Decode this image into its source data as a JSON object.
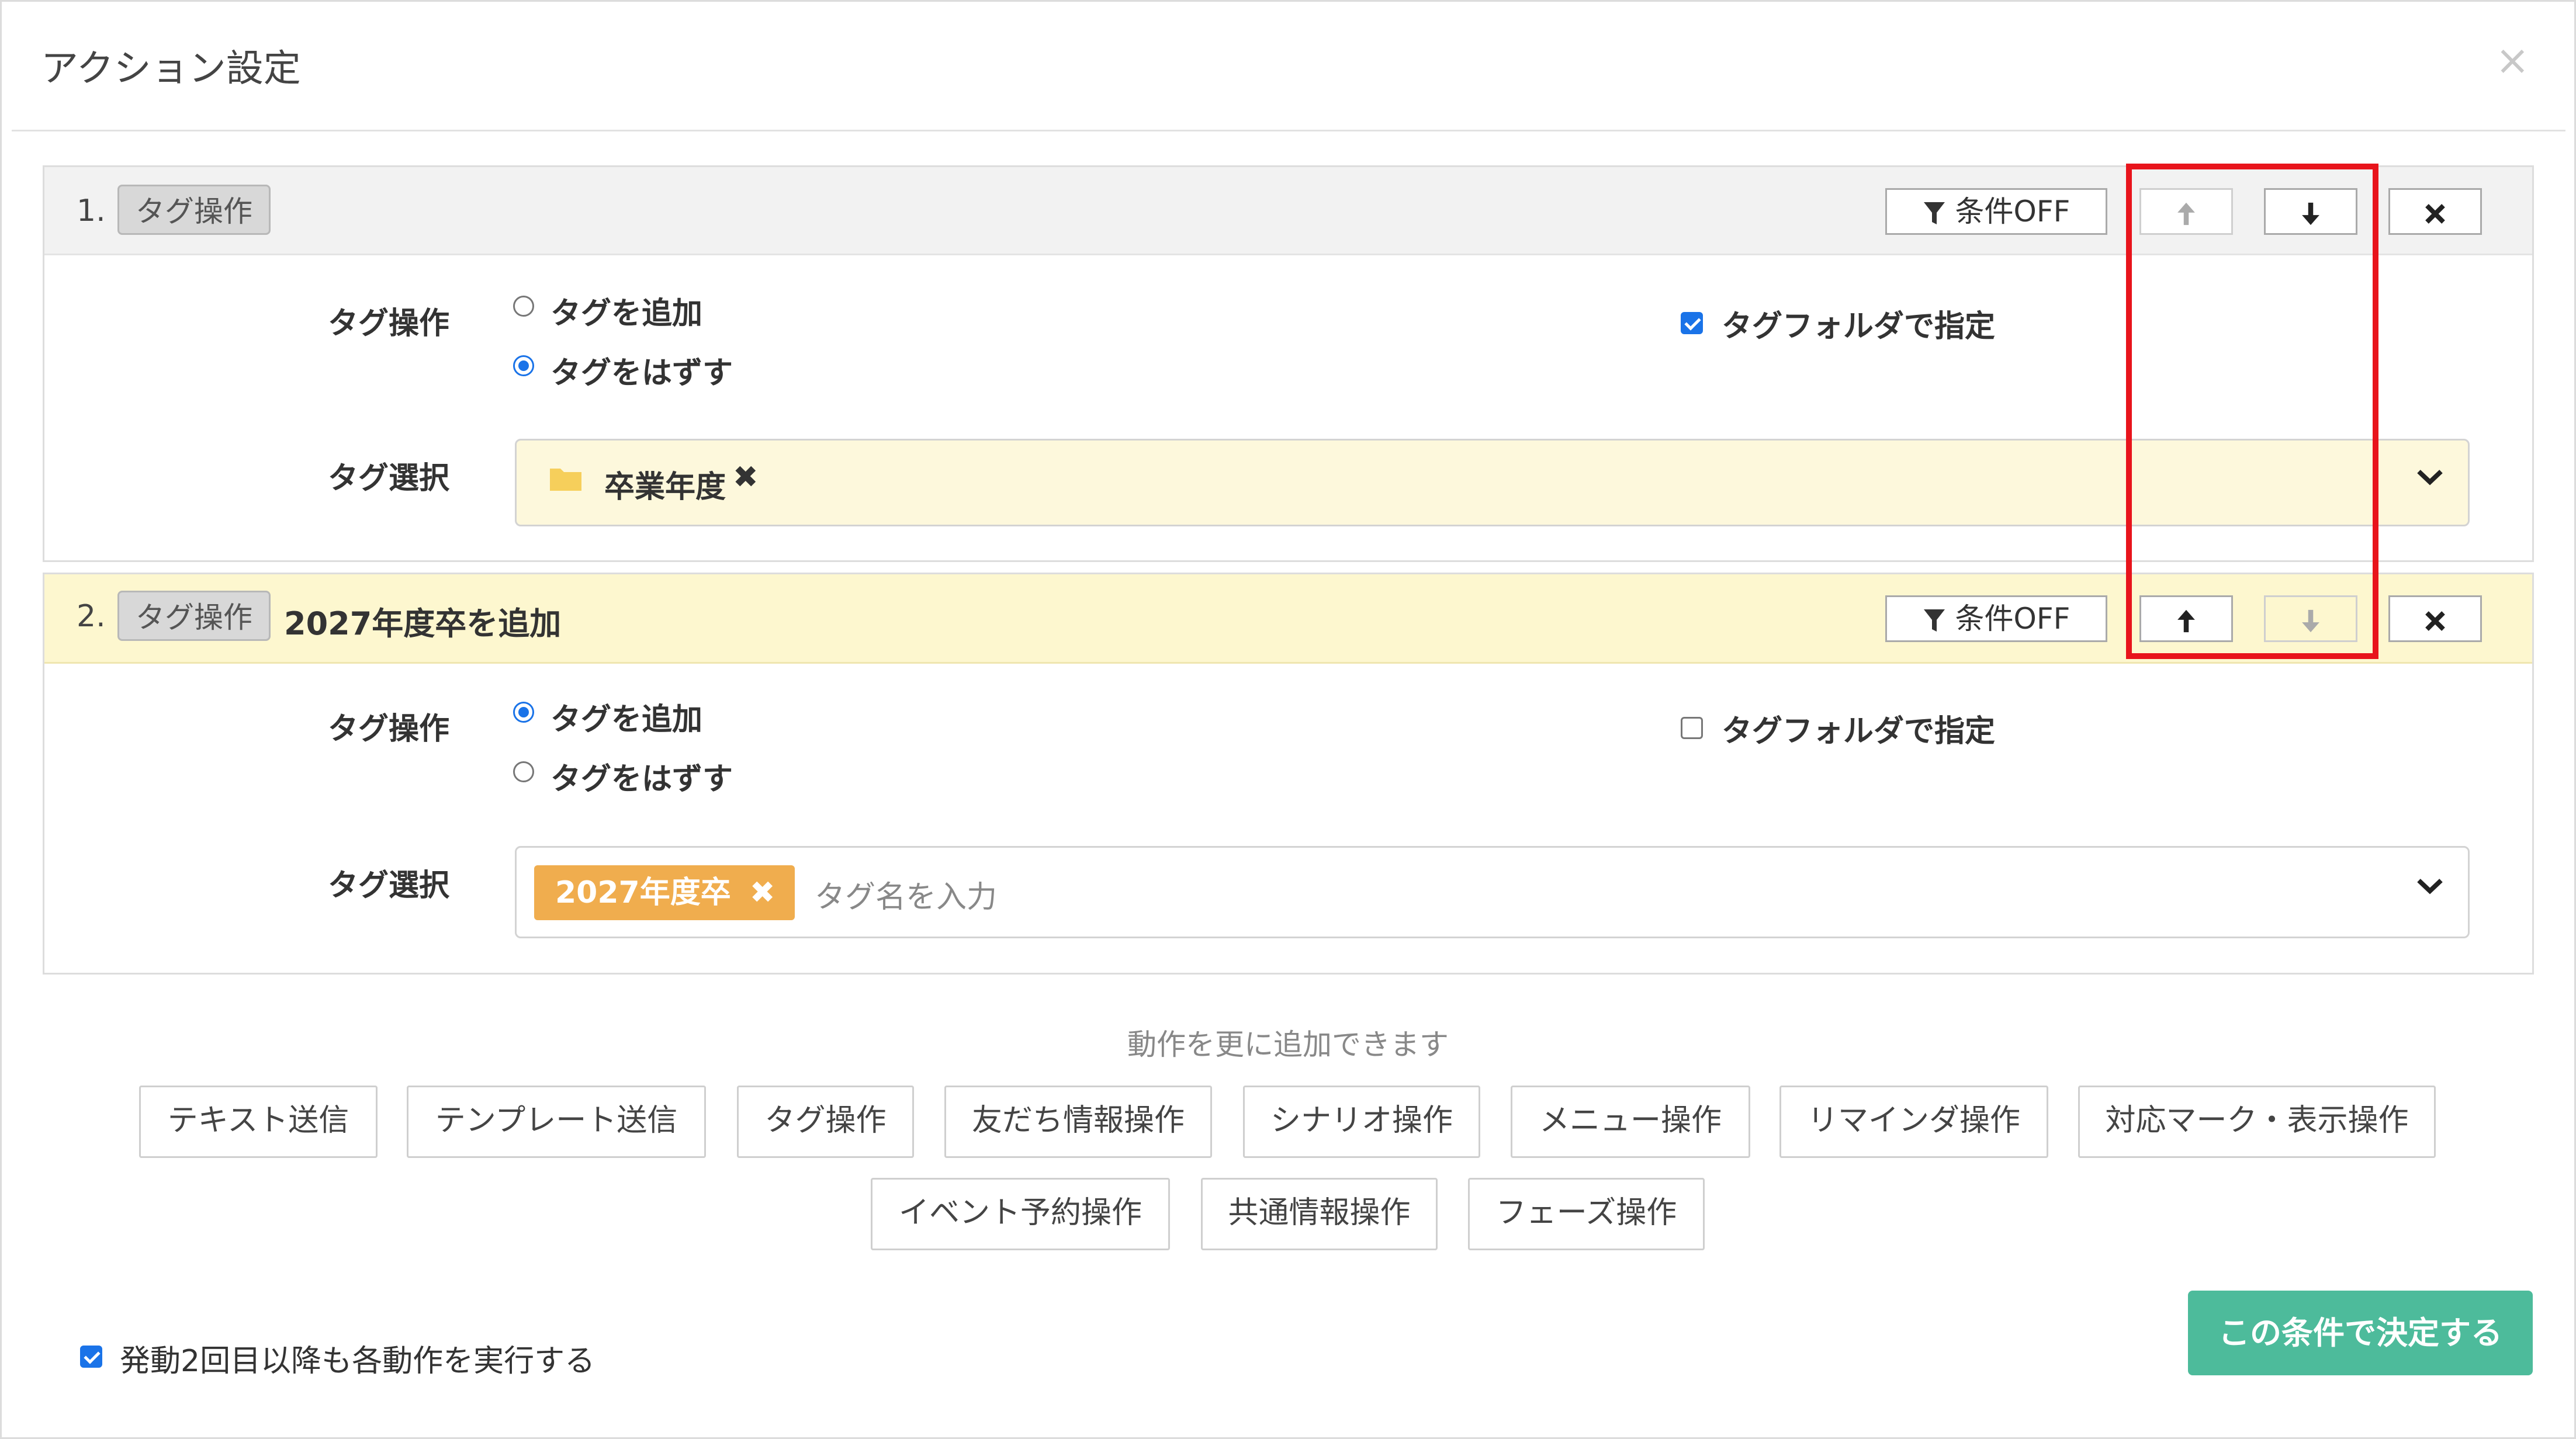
{
  "dialog": {
    "title": "アクション設定",
    "close_glyph": "×"
  },
  "header_buttons": {
    "condition_label": "条件OFF"
  },
  "actions": [
    {
      "number": "1.",
      "type_label": "タグ操作",
      "description": "",
      "tag_operation_label": "タグ操作",
      "options": [
        "タグを追加",
        "タグをはずす"
      ],
      "selected_option": "タグをはずす",
      "use_folder_label": "タグフォルダで指定",
      "use_folder_checked": true,
      "tag_select_label": "タグ選択",
      "selected_tags": [
        {
          "name": "卒業年度",
          "kind": "folder",
          "remove_glyph": "✖"
        }
      ],
      "placeholder": "",
      "move_up_enabled": false,
      "move_down_enabled": true
    },
    {
      "number": "2.",
      "type_label": "タグ操作",
      "description": "2027年度卒を追加",
      "tag_operation_label": "タグ操作",
      "options": [
        "タグを追加",
        "タグをはずす"
      ],
      "selected_option": "タグを追加",
      "use_folder_label": "タグフォルダで指定",
      "use_folder_checked": false,
      "tag_select_label": "タグ選択",
      "selected_tags": [
        {
          "name": "2027年度卒",
          "kind": "tag",
          "remove_glyph": "✖"
        }
      ],
      "placeholder": "タグ名を入力",
      "move_up_enabled": true,
      "move_down_enabled": false
    }
  ],
  "add_more_hint": "動作を更に追加できます",
  "action_buttons": [
    "テキスト送信",
    "テンプレート送信",
    "タグ操作",
    "友だち情報操作",
    "シナリオ操作",
    "メニュー操作",
    "リマインダ操作",
    "対応マーク・表示操作",
    "イベント予約操作",
    "共通情報操作",
    "フェーズ操作"
  ],
  "footer": {
    "repeat_label": "発動2回目以降も各動作を実行する",
    "repeat_checked": true,
    "submit_label": "この条件で決定する"
  },
  "icons": {
    "filter": "filter-icon",
    "up": "arrow-up-icon",
    "down": "arrow-down-icon",
    "delete": "delete-icon",
    "folder": "folder-icon",
    "caret": "chevron-down-icon"
  },
  "colors": {
    "accent_blue": "#1a73e8",
    "tag_orange": "#f0ad4e",
    "submit_green": "#4dbb9b",
    "highlight_red": "#e8141c",
    "panel_yellow": "#fdf8dc"
  }
}
